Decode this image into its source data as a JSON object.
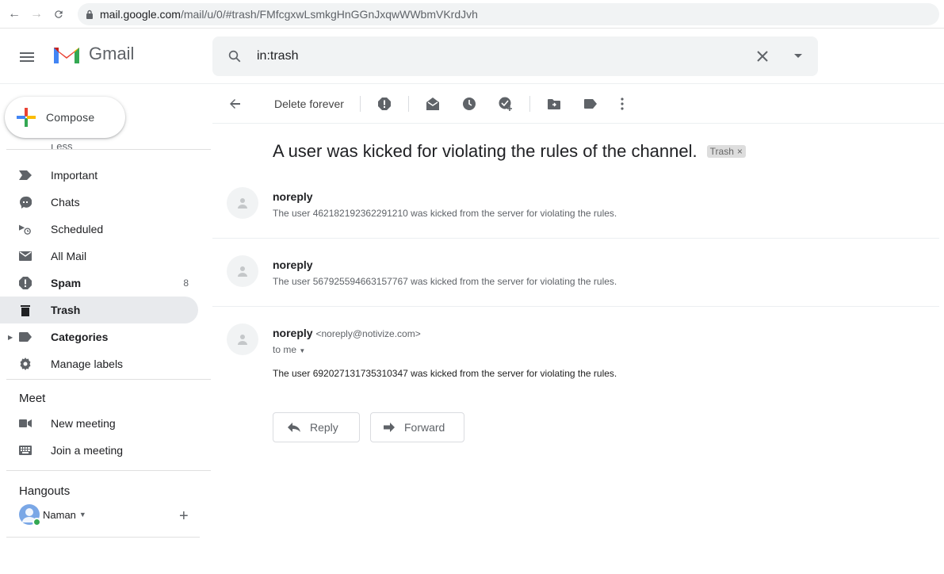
{
  "browser": {
    "url_host": "mail.google.com",
    "url_rest": "/mail/u/0/#trash/FMfcgxwLsmkgHnGGnJxqwWWbmVKrdJvh"
  },
  "header": {
    "app_name": "Gmail",
    "search_value": "in:trash"
  },
  "sidebar": {
    "compose_label": "Compose",
    "cut_off_item": "Less",
    "items": [
      {
        "label": "Important",
        "icon": "label-important-icon"
      },
      {
        "label": "Chats",
        "icon": "chat-icon"
      },
      {
        "label": "Scheduled",
        "icon": "scheduled-send-icon"
      },
      {
        "label": "All Mail",
        "icon": "all-mail-icon"
      },
      {
        "label": "Spam",
        "icon": "spam-icon",
        "count": "8"
      },
      {
        "label": "Trash",
        "icon": "trash-icon"
      },
      {
        "label": "Categories",
        "icon": "label-icon"
      },
      {
        "label": "Manage labels",
        "icon": "gear-icon"
      }
    ],
    "meet_title": "Meet",
    "meet_items": [
      {
        "label": "New meeting",
        "icon": "video-camera-icon"
      },
      {
        "label": "Join a meeting",
        "icon": "keyboard-icon"
      }
    ],
    "hangouts_title": "Hangouts",
    "hangouts_user": "Naman"
  },
  "toolbar": {
    "delete_forever": "Delete forever"
  },
  "thread": {
    "subject": "A user was kicked for violating the rules of the channel.",
    "label_chip": "Trash",
    "messages": [
      {
        "from": "noreply",
        "snippet": "The user 462182192362291210 was kicked from the server for violating the rules."
      },
      {
        "from": "noreply",
        "snippet": "The user 567925594663157767 was kicked from the server for violating the rules."
      },
      {
        "from": "noreply",
        "email": "<noreply@notivize.com>",
        "to": "to me",
        "body": "The user 692027131735310347 was kicked from the server for violating the rules."
      }
    ],
    "reply_label": "Reply",
    "forward_label": "Forward"
  },
  "colors": {
    "active_nav": "#e8eaed",
    "gmail_red": "#ea4335",
    "icon_gray": "#5f6368"
  }
}
